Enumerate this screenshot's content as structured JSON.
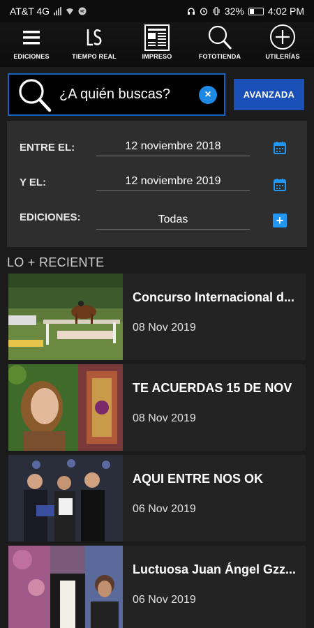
{
  "status_bar": {
    "carrier": "AT&T 4G",
    "battery": "32%",
    "time": "4:02 PM"
  },
  "top_nav": [
    {
      "label": "EDICIONES",
      "icon": "menu-icon"
    },
    {
      "label": "TIEMPO REAL",
      "icon": "ls-logo-icon"
    },
    {
      "label": "IMPRESO",
      "icon": "newspaper-icon"
    },
    {
      "label": "FOTOTIENDA",
      "icon": "search-icon"
    },
    {
      "label": "UTILERÍAS",
      "icon": "plus-circle-icon"
    }
  ],
  "search": {
    "placeholder": "¿A quién buscas?",
    "advanced_label": "AVANZADA"
  },
  "filters": {
    "from_label": "ENTRE EL:",
    "from_value": "12 noviembre 2018",
    "to_label": "Y EL:",
    "to_value": "12 noviembre 2019",
    "editions_label": "EDICIONES:",
    "editions_value": "Todas"
  },
  "recent": {
    "title": "LO + RECIENTE",
    "items": [
      {
        "title": "Concurso Internacional d...",
        "date": "08 Nov 2019"
      },
      {
        "title": "TE ACUERDAS  15 DE NOV",
        "date": "08 Nov 2019"
      },
      {
        "title": "AQUI ENTRE NOS OK",
        "date": "06 Nov 2019"
      },
      {
        "title": "Luctuosa Juan Ángel Gzz...",
        "date": "06 Nov 2019"
      }
    ]
  },
  "colors": {
    "accent": "#1e88e5",
    "button": "#1a4fb8",
    "panel": "#2e2e2e",
    "background": "#1b1b1b"
  }
}
